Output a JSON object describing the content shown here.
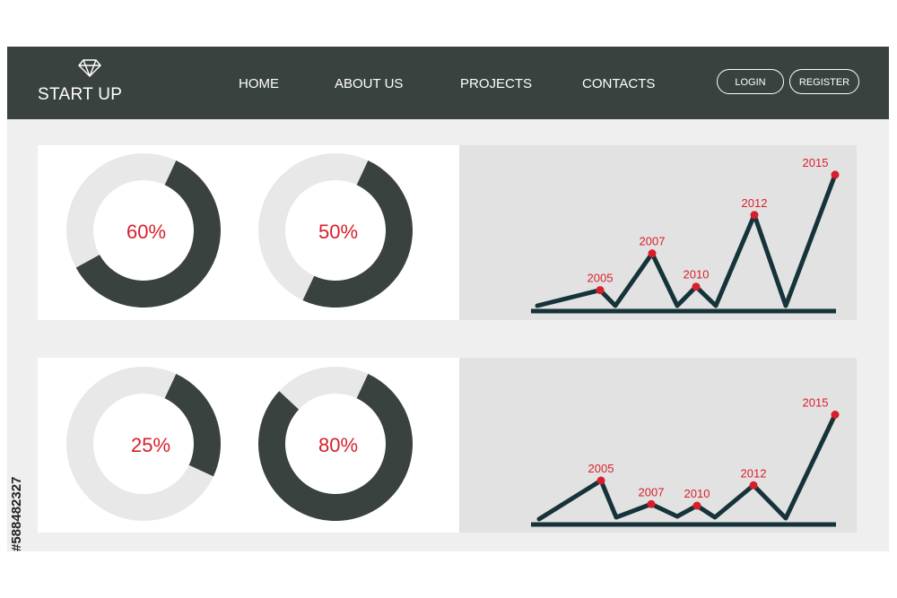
{
  "header": {
    "brand": "START UP",
    "brand_icon": "diamond-icon",
    "nav": [
      "HOME",
      "ABOUT US",
      "PROJECTS",
      "CONTACTS"
    ],
    "login_label": "LOGIN",
    "register_label": "REGISTER"
  },
  "colors": {
    "dark": "#3a4240",
    "track": "#e8e8e8",
    "accent": "#d71f2b",
    "line": "#16333a"
  },
  "donuts": [
    {
      "label": "60%",
      "value": 0.6
    },
    {
      "label": "50%",
      "value": 0.5
    },
    {
      "label": "25%",
      "value": 0.25
    },
    {
      "label": "80%",
      "value": 0.8
    }
  ],
  "chart_data": [
    {
      "type": "line",
      "x": [
        "2005",
        "2007",
        "2010",
        "2012",
        "2015"
      ],
      "values": [
        1.2,
        3.3,
        1.4,
        5.5,
        7.8
      ],
      "xlabel": "",
      "ylabel": "",
      "grid": false
    },
    {
      "type": "line",
      "x": [
        "2005",
        "2007",
        "2010",
        "2012",
        "2015"
      ],
      "values": [
        2.8,
        1.3,
        1.2,
        2.5,
        7.0
      ],
      "xlabel": "",
      "ylabel": "",
      "grid": false
    }
  ],
  "watermark": "#588482327"
}
